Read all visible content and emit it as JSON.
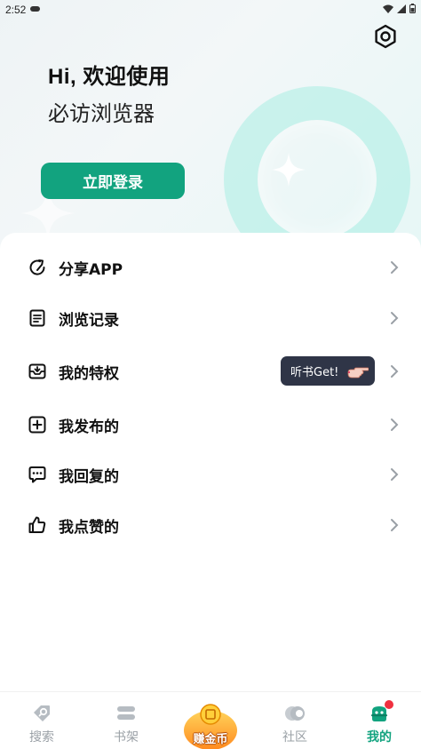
{
  "status_bar": {
    "time": "2:52"
  },
  "header": {
    "greeting": "Hi, 欢迎使用",
    "app_name": "必访浏览器",
    "login_label": "立即登录"
  },
  "menu": {
    "items": [
      {
        "label": "分享APP",
        "icon": "share-icon"
      },
      {
        "label": "浏览记录",
        "icon": "history-icon"
      },
      {
        "label": "我的特权",
        "icon": "privilege-icon"
      },
      {
        "label": "我发布的",
        "icon": "publish-icon"
      },
      {
        "label": "我回复的",
        "icon": "reply-icon"
      },
      {
        "label": "我点赞的",
        "icon": "like-icon"
      }
    ],
    "tooltip": "听书Get!"
  },
  "tabbar": {
    "tabs": [
      {
        "label": "搜索",
        "icon": "search-tag-icon"
      },
      {
        "label": "书架",
        "icon": "bookshelf-icon"
      },
      {
        "label": "赚金币",
        "icon": "coin-icon"
      },
      {
        "label": "社区",
        "icon": "community-icon"
      },
      {
        "label": "我的",
        "icon": "profile-icon",
        "active": true
      }
    ]
  },
  "colors": {
    "accent": "#12a37f",
    "tooltip_bg": "#2f3547",
    "inactive_tab": "#9aa0a6",
    "notification_dot": "#f0303f"
  }
}
